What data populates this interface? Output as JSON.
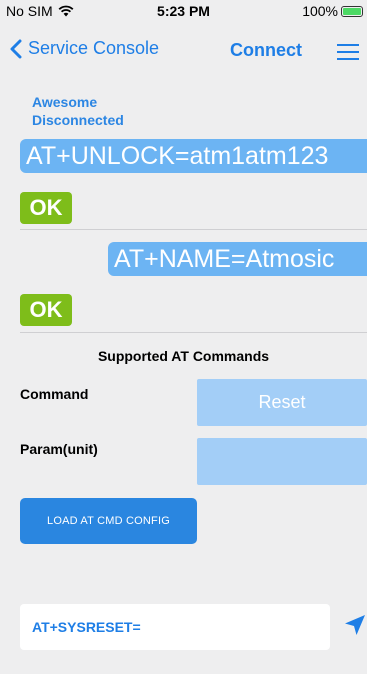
{
  "status_bar": {
    "carrier": "No SIM",
    "time": "5:23 PM",
    "battery": "100%"
  },
  "nav": {
    "back_label": "Service Console",
    "connect_label": "Connect"
  },
  "device": {
    "name": "Awesome",
    "state": "Disconnected"
  },
  "log": [
    {
      "command": "AT+UNLOCK=atm1atm123",
      "response": "OK"
    },
    {
      "command": "AT+NAME=Atmosic",
      "response": "OK"
    }
  ],
  "commands_section": {
    "title": "Supported AT Commands",
    "command_label": "Command",
    "command_value": "Reset",
    "param_label": "Param(unit)",
    "param_value": "",
    "load_button": "LOAD AT CMD CONFIG"
  },
  "input": {
    "value": "AT+SYSRESET="
  },
  "colors": {
    "accent": "#1e7ee6",
    "bubble": "#6cb4f3",
    "ok": "#7ebd1a",
    "select": "#a3cef7",
    "button": "#2a86e0"
  },
  "icons": [
    "wifi-icon",
    "battery-icon",
    "chevron-left-icon",
    "menu-icon",
    "send-icon"
  ]
}
